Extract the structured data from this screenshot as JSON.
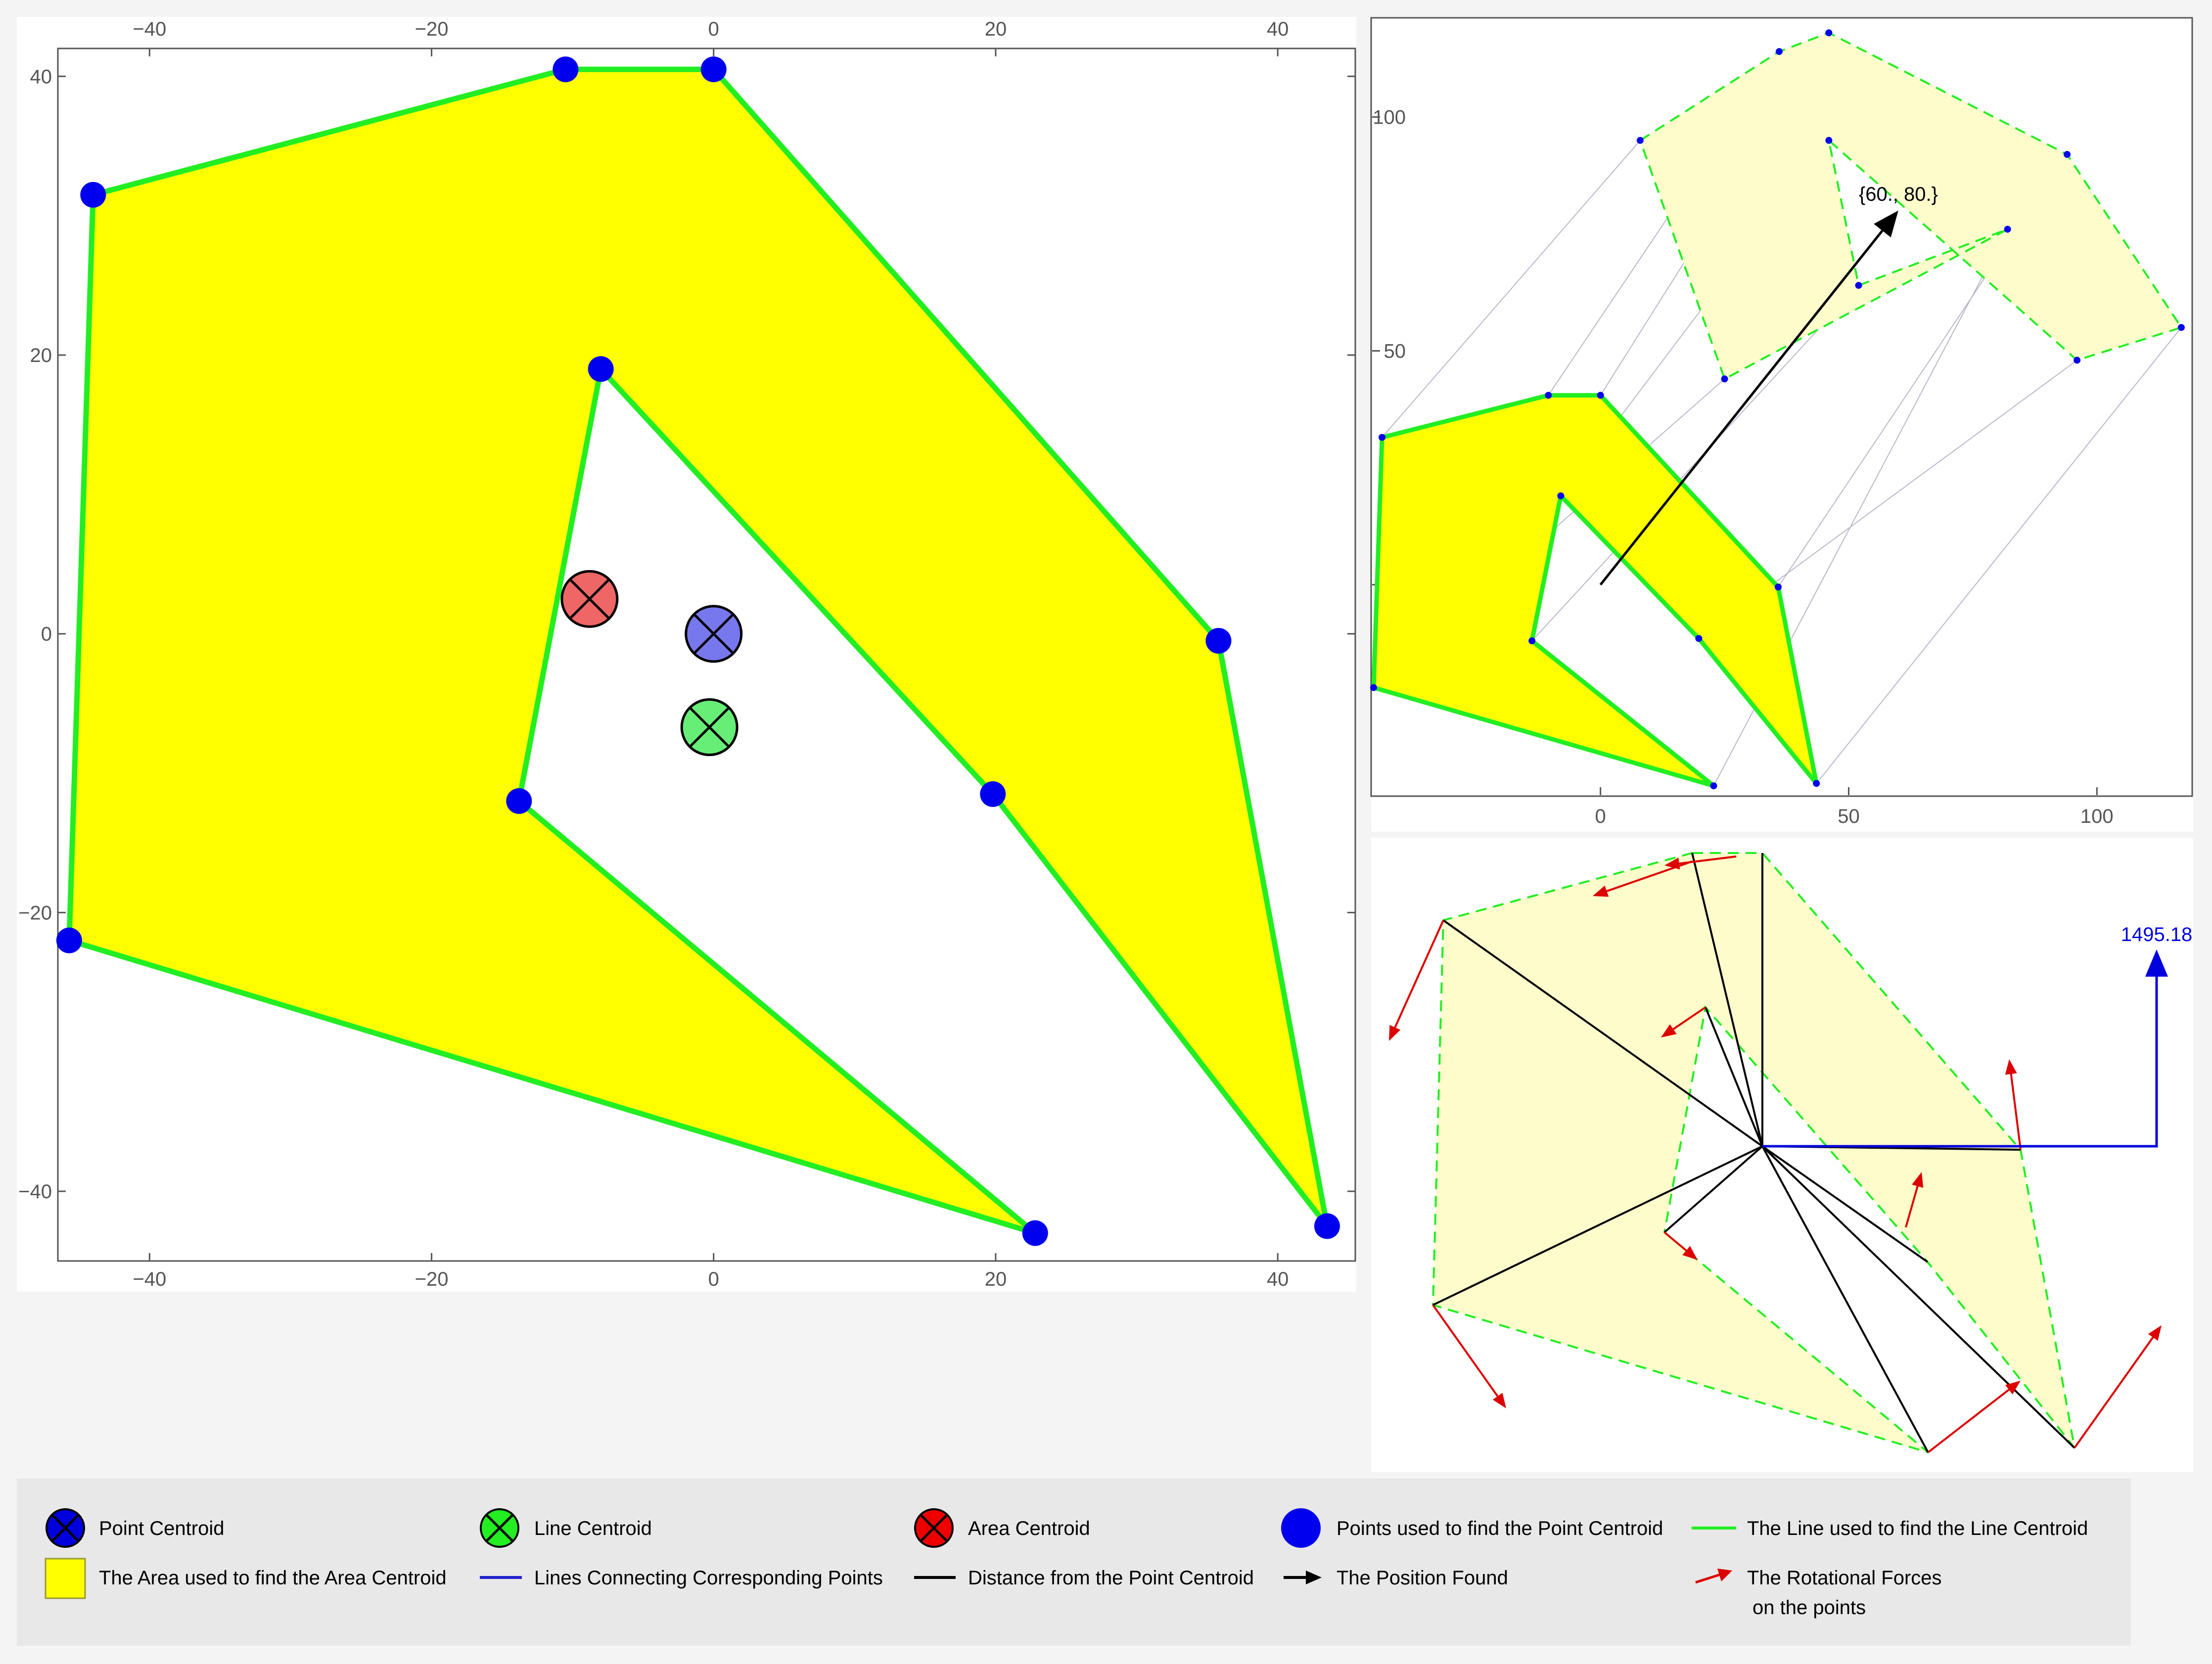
{
  "colors": {
    "page_background": "#f4f4f4",
    "panel_background": "#ffffff",
    "area_fill": "#ffff00",
    "area_fill_faded": "#fffccc",
    "polygon_edge": "#22ee22",
    "points": "#0000ee",
    "correspondence_lines": "#b8b8cc",
    "point_centroid": "#7777ee",
    "line_centroid": "#66ee77",
    "area_centroid": "#ee6666",
    "position_arrow": "#000000",
    "rotational_force": "#dd0000",
    "torque_arrow": "#0000dd",
    "legend_background": "#e8e8e8",
    "axis_text": "#555555"
  },
  "main_plot": {
    "x_range": [
      -46.5,
      45.5
    ],
    "y_range": [
      -45,
      42
    ],
    "x_ticks": [
      -40,
      -20,
      0,
      20,
      40
    ],
    "y_ticks": [
      -40,
      -20,
      0,
      20,
      40
    ],
    "x_tick_labels": [
      "−40",
      "−20",
      "0",
      "20",
      "40"
    ],
    "y_tick_labels": [
      "−40",
      "−20",
      "0",
      "20",
      "40"
    ],
    "polygon": [
      [
        -44,
        31.5
      ],
      [
        -10.5,
        40.5
      ],
      [
        0,
        40.5
      ],
      [
        35.8,
        -0.5
      ],
      [
        43.5,
        -42.5
      ],
      [
        19.8,
        -11.5
      ],
      [
        -8,
        19
      ],
      [
        -13.8,
        -12
      ],
      [
        22.8,
        -43
      ],
      [
        -45.7,
        -22
      ]
    ],
    "centroids": [
      {
        "name": "Area Centroid",
        "x": -8.8,
        "y": 2.5
      },
      {
        "name": "Point Centroid",
        "x": 0,
        "y": 0
      },
      {
        "name": "Line Centroid",
        "x": -0.3,
        "y": -6.7
      }
    ]
  },
  "translation_plot": {
    "x_range": [
      -46,
      119
    ],
    "y_range": [
      -45,
      121
    ],
    "x_ticks": [
      0,
      50,
      100
    ],
    "y_ticks": [
      0,
      50,
      100
    ],
    "x_tick_labels": [
      "0",
      "50",
      "100"
    ],
    "y_tick_labels": [
      "0",
      "50",
      "100"
    ],
    "original_polygon": [
      [
        -44,
        31.5
      ],
      [
        -10.5,
        40.5
      ],
      [
        0,
        40.5
      ],
      [
        35.8,
        -0.5
      ],
      [
        43.5,
        -42.5
      ],
      [
        19.8,
        -11.5
      ],
      [
        -8,
        19
      ],
      [
        -13.8,
        -12
      ],
      [
        22.8,
        -43
      ],
      [
        -45.7,
        -22
      ]
    ],
    "moved_polygon": [
      [
        8,
        95
      ],
      [
        36,
        114
      ],
      [
        46,
        118
      ],
      [
        94,
        92
      ],
      [
        117,
        55
      ],
      [
        96,
        48
      ],
      [
        46,
        95
      ],
      [
        52,
        64
      ],
      [
        82,
        76
      ],
      [
        25,
        44
      ]
    ],
    "arrow": {
      "from": [
        0,
        0
      ],
      "to": [
        60,
        80
      ]
    },
    "arrow_label": "{60., 80.}"
  },
  "forces_panel": {
    "torque_value_label": "1495.18"
  },
  "legend": {
    "row1": [
      {
        "icon": "point-centroid",
        "label": "Point Centroid"
      },
      {
        "icon": "line-centroid",
        "label": "Line Centroid"
      },
      {
        "icon": "area-centroid",
        "label": "Area Centroid"
      },
      {
        "icon": "points",
        "label": "Points used to find the Point Centroid"
      },
      {
        "icon": "line",
        "label": "The Line used to find the Line Centroid"
      }
    ],
    "row2": [
      {
        "icon": "area",
        "label": "The Area used to find the Area Centroid"
      },
      {
        "icon": "connecting-lines",
        "label": "Lines Connecting Corresponding Points"
      },
      {
        "icon": "distance",
        "label": "Distance from the Point Centroid"
      },
      {
        "icon": "position",
        "label": "The Position Found"
      },
      {
        "icon": "forces",
        "label": "The Rotational Forces",
        "label2": "on the points"
      }
    ]
  }
}
